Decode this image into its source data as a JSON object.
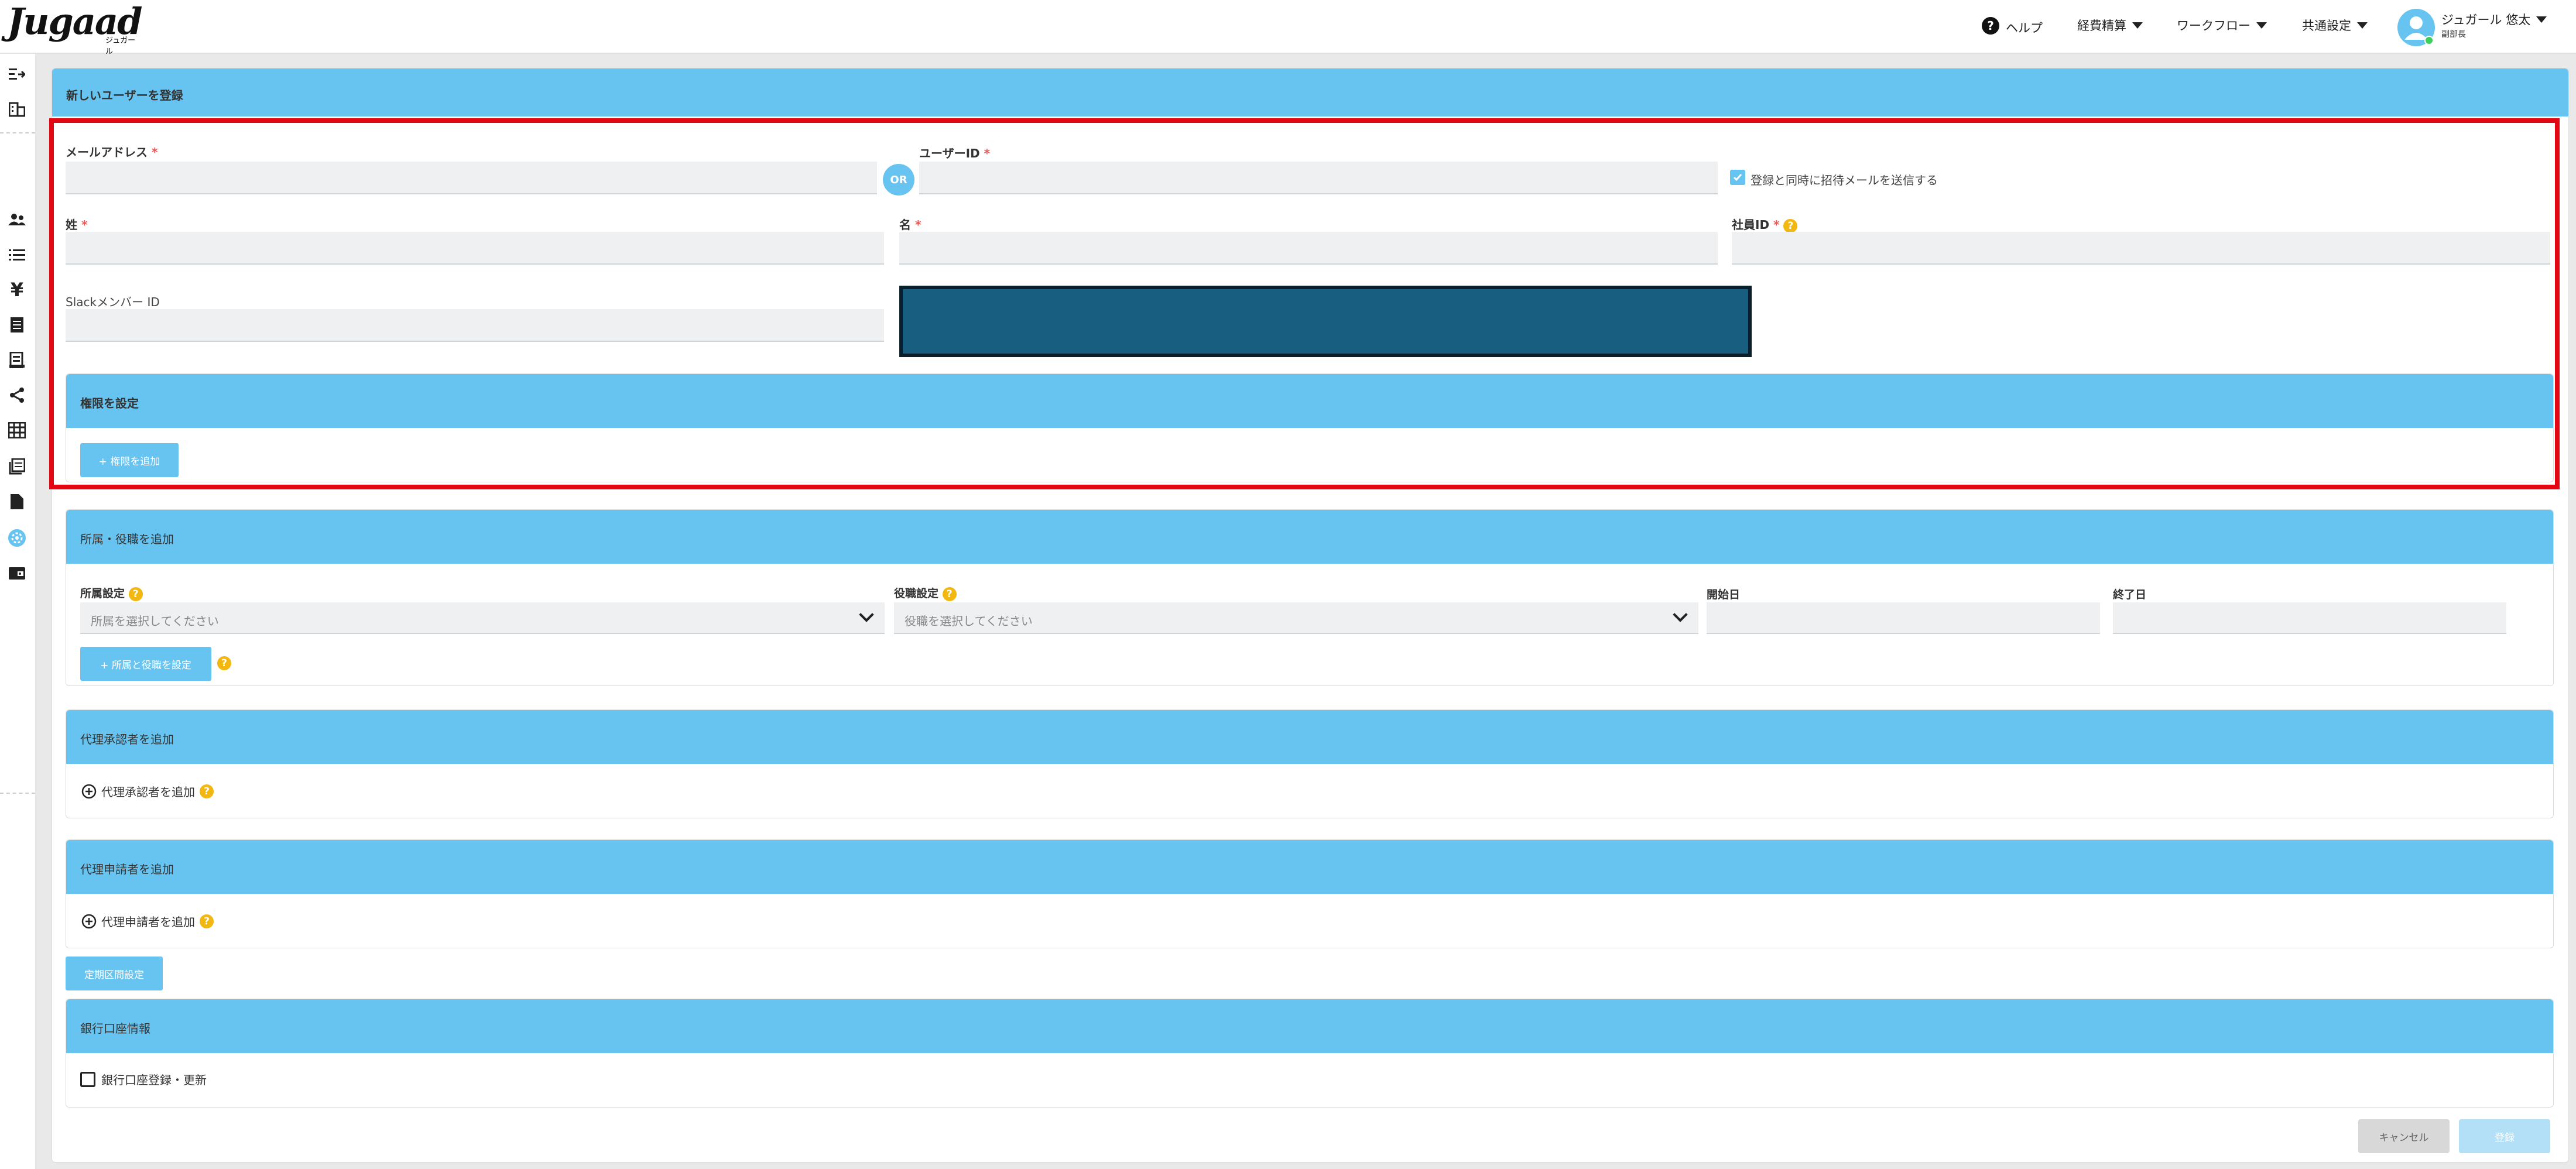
{
  "header": {
    "logo_text": "Jugaad",
    "logo_sub": "ジュガール",
    "help_label": "ヘルプ",
    "nav": [
      "経費精算",
      "ワークフロー",
      "共通設定"
    ],
    "user_name": "ジュガール 悠太",
    "user_role": "副部長"
  },
  "sidebar": {
    "icons": [
      "collapse-icon",
      "company-icon",
      "users-icon",
      "list-icon",
      "yen-icon",
      "document-icon",
      "receipt-icon",
      "share-icon",
      "table-icon",
      "library-icon",
      "file-icon",
      "settings-icon",
      "wallet-icon"
    ]
  },
  "page": {
    "title": "新しいユーザーを登録"
  },
  "form": {
    "email_label": "メールアドレス",
    "or_label": "OR",
    "userid_label": "ユーザーID",
    "invite_label": "登録と同時に招待メールを送信する",
    "invite_checked": true,
    "last_name_label": "姓",
    "first_name_label": "名",
    "employee_id_label": "社員ID",
    "slack_label": "Slackメンバー ID",
    "required_mark": "*"
  },
  "permissions": {
    "title": "権限を設定",
    "add_button": "+ 権限を追加"
  },
  "affiliation": {
    "title": "所属・役職を追加",
    "dept_label": "所属設定",
    "dept_placeholder": "所属を選択してください",
    "role_label": "役職設定",
    "role_placeholder": "役職を選択してください",
    "start_label": "開始日",
    "end_label": "終了日",
    "add_button": "+ 所属と役職を設定"
  },
  "proxy_approver": {
    "title": "代理承認者を追加",
    "add_label": "代理承認者を追加"
  },
  "proxy_applicant": {
    "title": "代理申請者を追加",
    "add_label": "代理申請者を追加"
  },
  "commute_button": "定期区間設定",
  "bank": {
    "title": "銀行口座情報",
    "checkbox_label": "銀行口座登録・更新"
  },
  "footer": {
    "cancel": "キャンセル",
    "submit": "登録"
  },
  "colors": {
    "accent": "#67c4f1",
    "highlight": "#e30613",
    "redacted": "#175e80",
    "help": "#f2b711"
  }
}
